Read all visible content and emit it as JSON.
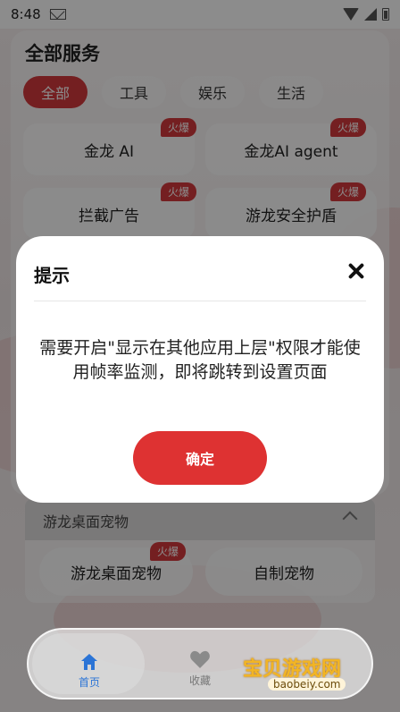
{
  "status": {
    "time": "8:48"
  },
  "page": {
    "section_title": "全部服务",
    "tabs": [
      {
        "label": "全部",
        "active": true
      },
      {
        "label": "工具",
        "active": false
      },
      {
        "label": "娱乐",
        "active": false
      },
      {
        "label": "生活",
        "active": false
      }
    ],
    "cards": [
      {
        "label": "金龙 AI",
        "badge": "火爆"
      },
      {
        "label": "金龙AI agent",
        "badge": "火爆"
      },
      {
        "label": "拦截广告",
        "badge": "火爆"
      },
      {
        "label": "游龙安全护盾",
        "badge": "火爆"
      },
      {
        "label": "游龙桌面宠物",
        "badge": "火爆"
      },
      {
        "label": "自制宠物",
        "badge": ""
      }
    ],
    "section2_title": "游龙桌面宠物"
  },
  "dialog": {
    "title": "提示",
    "message": "需要开启\"显示在其他应用上层\"权限才能使用帧率监测，即将跳转到设置页面",
    "confirm_label": "确定"
  },
  "bottom_nav": {
    "home_label": "首页",
    "favorites_label": "收藏"
  },
  "watermark": {
    "text": "宝贝游戏网",
    "url": "baobeiy.com"
  },
  "colors": {
    "accent": "#de3232",
    "home_blue": "#2b74d6"
  }
}
